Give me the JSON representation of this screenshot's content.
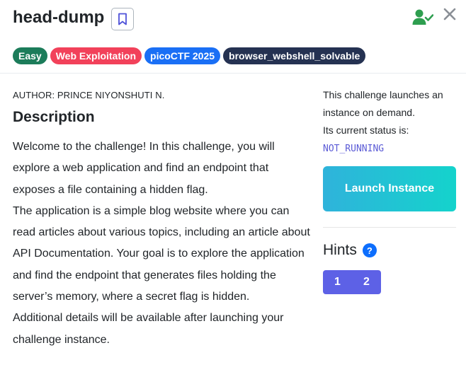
{
  "header": {
    "title": "head-dump",
    "bookmark_icon": "bookmark-icon",
    "user_check_icon": "user-check-icon",
    "close_icon": "close-icon"
  },
  "tags": [
    {
      "label": "Easy",
      "color": "#1c7c5a"
    },
    {
      "label": "Web Exploitation",
      "color": "#f2415a"
    },
    {
      "label": "picoCTF 2025",
      "color": "#1a6ff5"
    },
    {
      "label": "browser_webshell_solvable",
      "color": "#253252"
    }
  ],
  "content": {
    "author": "AUTHOR: PRINCE NIYONSHUTI N.",
    "description_heading": "Description",
    "paragraphs": [
      "Welcome to the challenge! In this challenge, you will explore a web application and find an endpoint that exposes a file containing a hidden flag.",
      "The application is a simple blog website where you can read articles about various topics, including an article about API Documentation. Your goal is to explore the application and find the endpoint that generates files holding the server’s memory, where a secret flag is hidden.",
      "Additional details will be available after launching your challenge instance."
    ]
  },
  "sidebar": {
    "launch_text_1": "This challenge launches an instance on demand.",
    "launch_text_2": "Its current status is:",
    "status": "NOT_RUNNING",
    "launch_button": "Launch Instance",
    "hints_heading": "Hints",
    "help_symbol": "?",
    "hints": [
      "1",
      "2"
    ]
  },
  "colors": {
    "accent_purple": "#5d61e6",
    "launch_gradient_start": "#2fb3db",
    "launch_gradient_end": "#14d3cc",
    "success_green": "#2e9e4f",
    "status_text": "#5b5bd6"
  }
}
